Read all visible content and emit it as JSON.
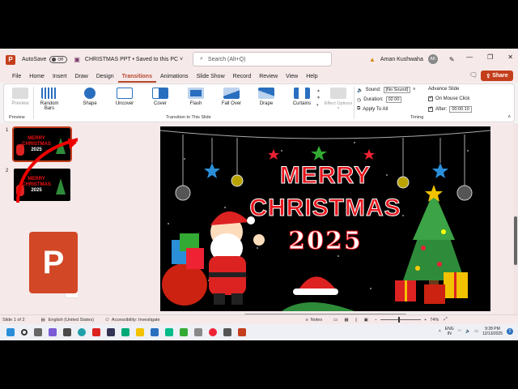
{
  "titlebar": {
    "autosave_label": "AutoSave",
    "autosave_state": "Off",
    "doc_title": "CHRISTMAS PPT • Saved to this PC ˅",
    "search_placeholder": "Search (Alt+Q)",
    "user_name": "Aman Kushwaha",
    "user_initials": "AK"
  },
  "menu": {
    "items": [
      "File",
      "Home",
      "Insert",
      "Draw",
      "Design",
      "Transitions",
      "Animations",
      "Slide Show",
      "Record",
      "Review",
      "View",
      "Help"
    ],
    "active": "Transitions",
    "share_label": "Share"
  },
  "ribbon": {
    "preview_label": "Preview",
    "preview_group": "Preview",
    "transitions": [
      "Random Bars",
      "Shape",
      "Uncover",
      "Cover",
      "Flash",
      "Fall Over",
      "Drape",
      "Curtains"
    ],
    "effect_options": "Effect Options ˅",
    "transitions_group": "Transition to This Slide",
    "sound_label": "Sound:",
    "sound_value": "[No Sound]",
    "duration_label": "Duration:",
    "duration_value": "02.00",
    "apply_all": "Apply To All",
    "advance_label": "Advance Slide",
    "on_click": "On Mouse Click",
    "after_label": "After:",
    "after_value": "00:00.10",
    "timing_group": "Timing"
  },
  "thumbnails": [
    {
      "num": "1",
      "line1": "MERRY",
      "line2": "CHRISTMAS",
      "line3": "2025"
    },
    {
      "num": "2",
      "line1": "MERRY",
      "line2": "CHRISTMAS",
      "line3": "2025"
    }
  ],
  "slide": {
    "line1": "MERRY",
    "line2": "CHRISTMAS",
    "line3": "2025"
  },
  "status": {
    "slide_count": "Slide 1 of 2",
    "language": "English (United States)",
    "accessibility": "Accessibility: Investigate",
    "notes": "Notes",
    "zoom": "74%"
  },
  "taskbar": {
    "lang": "ENG",
    "lang2": "IN",
    "time": "9:28 PM",
    "date": "12/13/2025"
  },
  "colors": {
    "accent": "#c43e1c",
    "title_red": "#e8141c",
    "bg_pink": "#f6e9ea"
  }
}
